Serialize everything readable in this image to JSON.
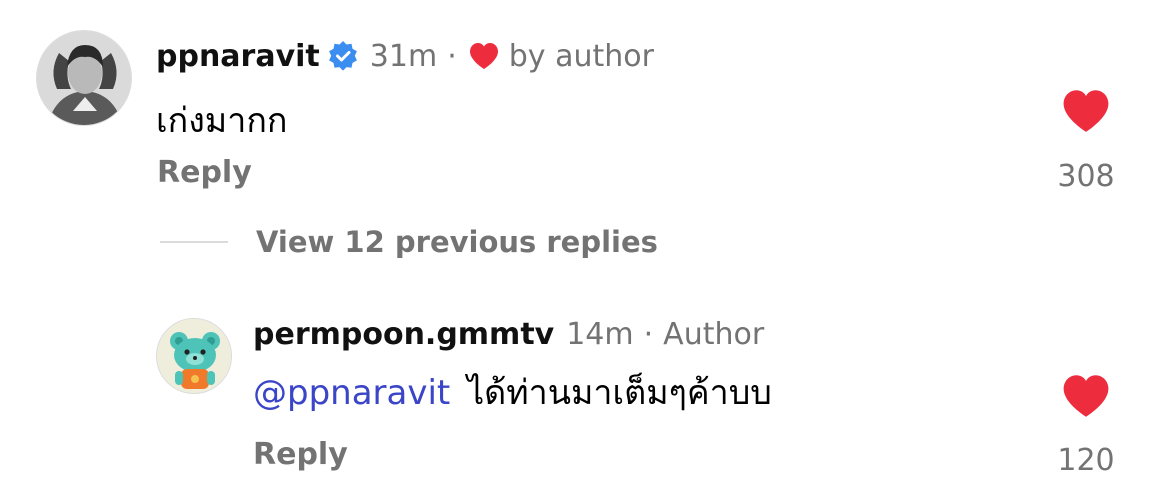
{
  "comments": [
    {
      "username": "ppnaravit",
      "time": "31m",
      "separator": "·",
      "by_author": "by author",
      "text": "เก่งมากก",
      "reply_label": "Reply",
      "likes": "308"
    }
  ],
  "view_replies": "View 12 previous replies",
  "replies": [
    {
      "username": "permpoon.gmmtv",
      "time": "14m",
      "separator": "·",
      "author_label": "Author",
      "mention": "@ppnaravit",
      "text": "ได้ท่านมาเต็มๆค้าบบ",
      "reply_label": "Reply",
      "likes": "120"
    }
  ],
  "colors": {
    "heart": "#ed2c3e",
    "verified": "#3b8df0",
    "mention": "#3a45c7",
    "muted": "#737373"
  },
  "icons": [
    "verified-badge-icon",
    "heart-icon",
    "like-heart-icon"
  ]
}
